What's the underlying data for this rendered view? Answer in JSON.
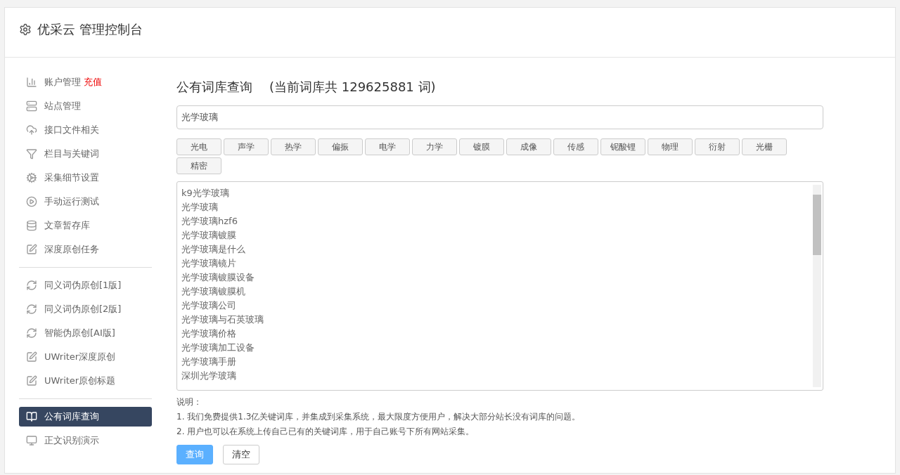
{
  "header": {
    "title": "优采云 管理控制台"
  },
  "sidebar": {
    "groups": [
      {
        "items": [
          {
            "label": "账户管理",
            "badge": "充值",
            "kind": "chart",
            "selected": false
          },
          {
            "label": "站点管理",
            "kind": "server",
            "selected": false
          },
          {
            "label": "接口文件相关",
            "kind": "cloud",
            "selected": false
          },
          {
            "label": "栏目与关键词",
            "kind": "filter",
            "selected": false
          },
          {
            "label": "采集细节设置",
            "kind": "gears",
            "selected": false
          },
          {
            "label": "手动运行测试",
            "kind": "play",
            "selected": false
          },
          {
            "label": "文章暂存库",
            "kind": "database",
            "selected": false
          },
          {
            "label": "深度原创任务",
            "kind": "edit",
            "selected": false
          }
        ]
      },
      {
        "items": [
          {
            "label": "同义词伪原创[1版]",
            "kind": "refresh",
            "selected": false
          },
          {
            "label": "同义词伪原创[2版]",
            "kind": "refresh",
            "selected": false
          },
          {
            "label": "智能伪原创[AI版]",
            "kind": "refresh",
            "selected": false
          },
          {
            "label": "UWriter深度原创",
            "kind": "edit",
            "selected": false
          },
          {
            "label": "UWriter原创标题",
            "kind": "edit",
            "selected": false
          }
        ]
      },
      {
        "items": [
          {
            "label": "公有词库查询",
            "kind": "book",
            "selected": true
          },
          {
            "label": "正文识别演示",
            "kind": "monitor",
            "selected": false
          }
        ]
      }
    ]
  },
  "main": {
    "title": "公有词库查询",
    "subtitle": "(当前词库共 129625881 词)",
    "search": {
      "value": "光学玻璃"
    },
    "tags": [
      "光电",
      "声学",
      "热学",
      "偏振",
      "电学",
      "力学",
      "镀膜",
      "成像",
      "传感",
      "铌酸锂",
      "物理",
      "衍射",
      "光栅",
      "精密"
    ],
    "results": [
      "k9光学玻璃",
      "光学玻璃",
      "光学玻璃hzf6",
      "光学玻璃镀膜",
      "光学玻璃是什么",
      "光学玻璃镜片",
      "光学玻璃镀膜设备",
      "光学玻璃镀膜机",
      "光学玻璃公司",
      "光学玻璃与石英玻璃",
      "光学玻璃价格",
      "光学玻璃加工设备",
      "光学玻璃手册",
      "深圳光学玻璃"
    ],
    "notes_title": "说明：",
    "notes": [
      "1. 我们免费提供1.3亿关键词库，并集成到采集系统，最大限度方便用户，解决大部分站长没有词库的问题。",
      "2. 用户也可以在系统上传自己已有的关键词库，用于自己账号下所有网站采集。"
    ],
    "buttons": [
      {
        "label": "查询",
        "kind": "primary"
      },
      {
        "label": "清空",
        "kind": "default"
      }
    ]
  }
}
